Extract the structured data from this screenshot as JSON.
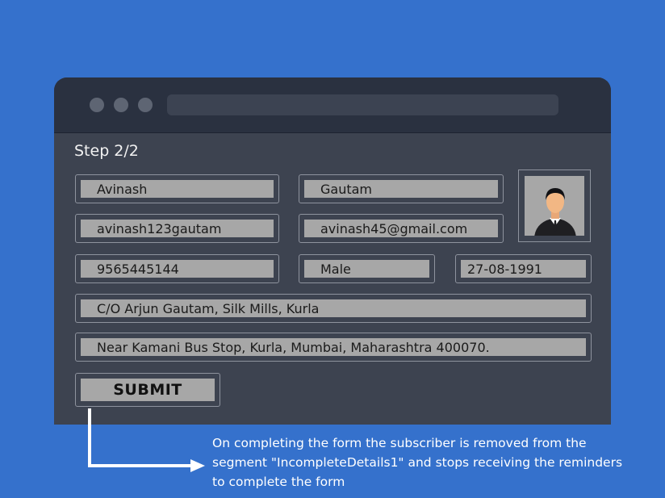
{
  "form": {
    "step": "Step 2/2",
    "first_name": "Avinash",
    "last_name": "Gautam",
    "username": "avinash123gautam",
    "email": "avinash45@gmail.com",
    "phone": "9565445144",
    "gender": "Male",
    "dob": "27-08-1991",
    "address_line1": "C/O Arjun Gautam, Silk Mills, Kurla",
    "address_line2": "Near Kamani Bus Stop, Kurla, Mumbai, Maharashtra 400070.",
    "submit_label": "SUBMIT",
    "avatar_icon": "user-avatar-icon"
  },
  "annotation": {
    "text": "On completing the form the subscriber is removed from the segment \"IncompleteDetails1\" and stops receiving the reminders to complete the form"
  },
  "colors": {
    "background": "#3571cc",
    "window": "#3d4350",
    "titlebar": "#2a3140",
    "field_fill": "#a7a7a7"
  }
}
